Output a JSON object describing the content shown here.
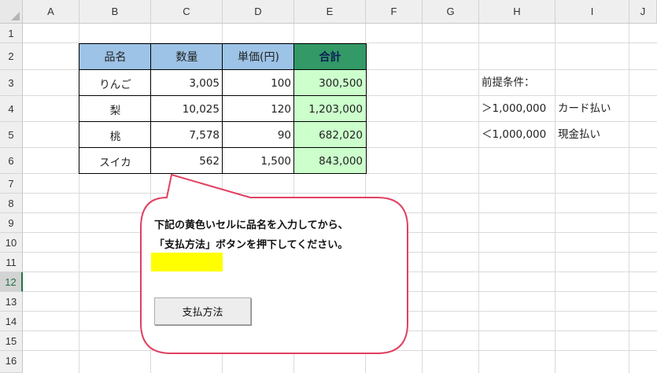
{
  "columns": [
    "A",
    "B",
    "C",
    "D",
    "E",
    "F",
    "G",
    "H",
    "I",
    "J"
  ],
  "rows": [
    "1",
    "2",
    "3",
    "4",
    "5",
    "6",
    "7",
    "8",
    "9",
    "10",
    "11",
    "12",
    "13",
    "14",
    "15",
    "16"
  ],
  "active_row": "12",
  "table": {
    "headers": [
      "品名",
      "数量",
      "単価(円)",
      "合計"
    ],
    "rows": [
      [
        "りんご",
        "3,005",
        "100",
        "300,500"
      ],
      [
        "梨",
        "10,025",
        "120",
        "1,203,000"
      ],
      [
        "桃",
        "7,578",
        "90",
        "682,020"
      ],
      [
        "スイカ",
        "562",
        "1,500",
        "843,000"
      ]
    ]
  },
  "conditions": {
    "title": "前提条件：",
    "rules": [
      {
        "condition": "＞1,000,000",
        "method": "カード払い"
      },
      {
        "condition": "＜1,000,000",
        "method": "現金払い"
      }
    ]
  },
  "callout": {
    "line1": "下記の黄色いセルに品名を入力してから、",
    "line2": "「支払方法」ボタンを押下してください。"
  },
  "button": {
    "label": "支払方法"
  },
  "colors": {
    "header_blue": "#9dc3e6",
    "header_green": "#339966",
    "total_fill": "#ccffcc",
    "callout_border": "#e04060",
    "input_yellow": "#ffff00",
    "active_row_green": "#217346"
  }
}
